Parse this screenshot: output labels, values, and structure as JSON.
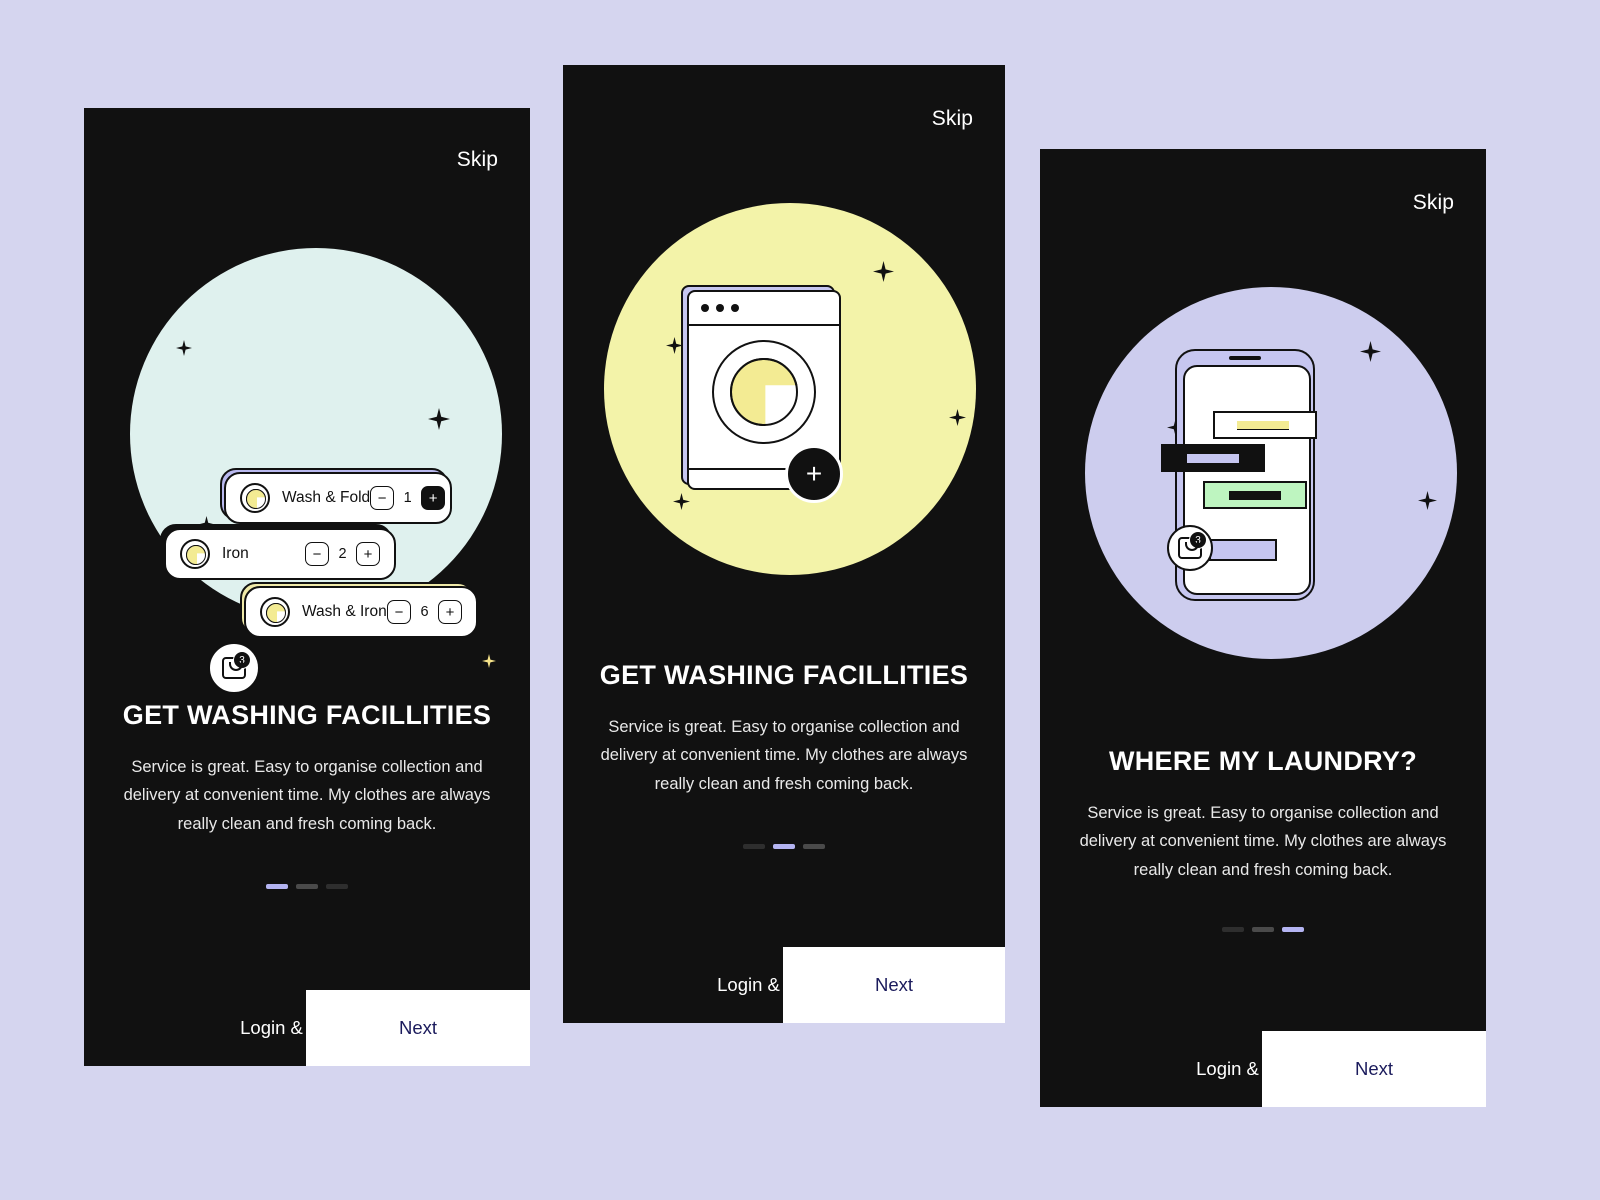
{
  "background_color": "#d5d5ef",
  "screens": [
    {
      "id": "screen1",
      "skip_label": "Skip",
      "blob_color": "#dff1ee",
      "headline": "GET WASHING FACILLITIES",
      "subcopy": "Service is great. Easy to organise collection and delivery at convenient time. My clothes are always really clean and fresh coming back.",
      "login_label": "Login & Sign Up",
      "next_label": "Next",
      "pagination": {
        "total": 3,
        "active_index": 0,
        "active_color": "#b4b4f2"
      },
      "illustration": "service-cards",
      "bag_badge_count": "3",
      "service_cards": [
        {
          "icon": "laundry-item-icon",
          "name": "Wash & Fold",
          "quantity": "1",
          "minus_label": "−",
          "plus_label": "+",
          "plus_filled": true,
          "shadow_color": "#b9b9ef"
        },
        {
          "icon": "laundry-item-icon",
          "name": "Iron",
          "quantity": "2",
          "minus_label": "−",
          "plus_label": "+",
          "plus_filled": false,
          "shadow_color": "#111111"
        },
        {
          "icon": "laundry-item-icon",
          "name": "Wash & Iron",
          "quantity": "6",
          "minus_label": "−",
          "plus_label": "+",
          "plus_filled": false,
          "shadow_color": "#efe9a8"
        }
      ]
    },
    {
      "id": "screen2",
      "skip_label": "Skip",
      "blob_color": "#f3f3a9",
      "headline": "GET WASHING FACILLITIES",
      "subcopy": "Service is great. Easy to organise collection and delivery at convenient time. My clothes are always really clean and fresh coming back.",
      "login_label": "Login & Sign Up",
      "next_label": "Next",
      "pagination": {
        "total": 3,
        "active_index": 1,
        "active_color": "#b4b4f2"
      },
      "illustration": "washing-machine",
      "fab_label": "+"
    },
    {
      "id": "screen3",
      "skip_label": "Skip",
      "blob_color": "#cdcdee",
      "headline": "WHERE MY LAUNDRY?",
      "subcopy": "Service is great. Easy to organise collection and delivery at convenient time. My clothes are always really clean and fresh coming back.",
      "login_label": "Login & Sign Up",
      "next_label": "Next",
      "pagination": {
        "total": 3,
        "active_index": 2,
        "active_color": "#b4b4f2"
      },
      "illustration": "phone-notifications",
      "bag_badge_count": "3"
    }
  ]
}
